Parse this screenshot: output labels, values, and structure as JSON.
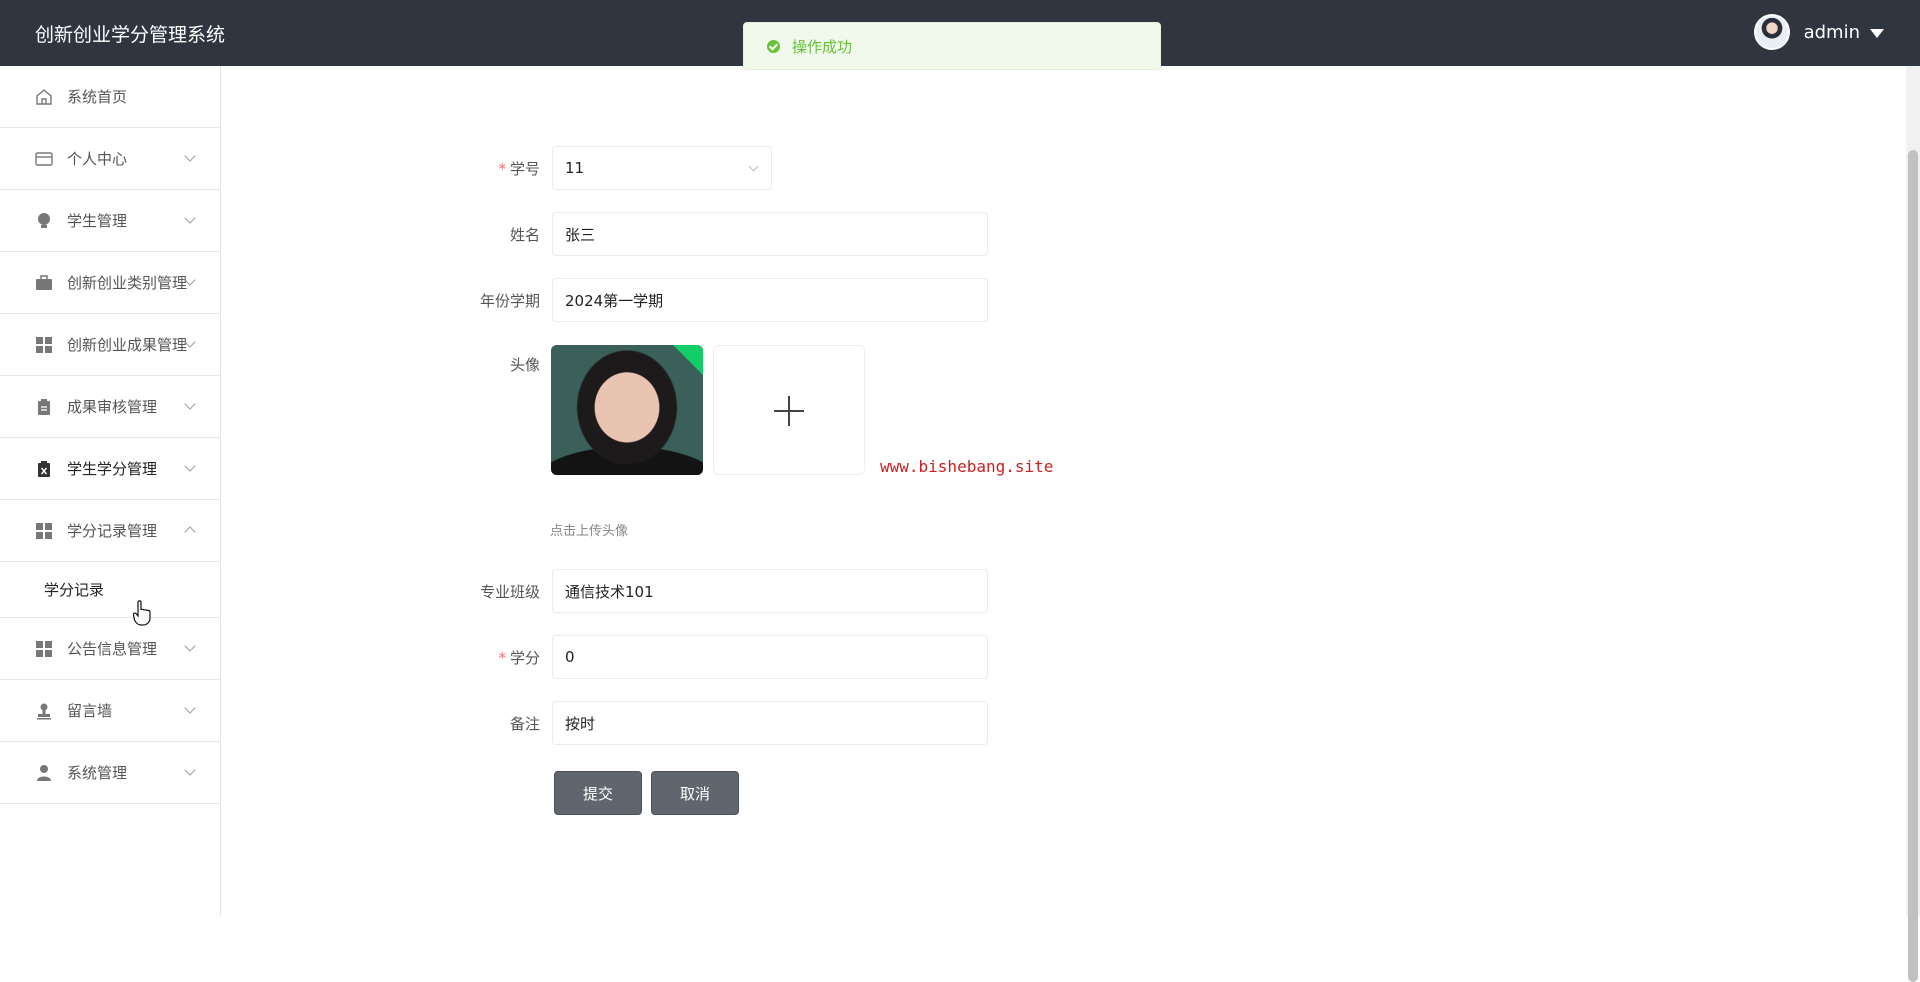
{
  "app": {
    "title": "创新创业学分管理系统"
  },
  "user": {
    "name": "admin"
  },
  "toast": {
    "message": "操作成功"
  },
  "sidebar": {
    "items": [
      {
        "label": "系统首页",
        "icon": "home-icon"
      },
      {
        "label": "个人中心",
        "icon": "wallet-icon"
      },
      {
        "label": "学生管理",
        "icon": "bulb-icon"
      },
      {
        "label": "创新创业类别管理",
        "icon": "briefcase-icon"
      },
      {
        "label": "创新创业成果管理",
        "icon": "grid-icon"
      },
      {
        "label": "成果审核管理",
        "icon": "clipboard-icon"
      },
      {
        "label": "学生学分管理",
        "icon": "clipboard-x-icon"
      },
      {
        "label": "学分记录管理",
        "icon": "grid-icon",
        "expanded": true
      },
      {
        "label": "公告信息管理",
        "icon": "grid-icon"
      },
      {
        "label": "留言墙",
        "icon": "stamp-icon"
      },
      {
        "label": "系统管理",
        "icon": "user-icon"
      }
    ],
    "submenu": {
      "label": "学分记录"
    }
  },
  "form": {
    "student_id": {
      "label": "学号",
      "value": "11",
      "required": true
    },
    "name": {
      "label": "姓名",
      "value": "张三"
    },
    "semester": {
      "label": "年份学期",
      "value": "2024第一学期"
    },
    "avatar": {
      "label": "头像",
      "hint": "点击上传头像"
    },
    "class": {
      "label": "专业班级",
      "value": "通信技术101"
    },
    "credit": {
      "label": "学分",
      "value": "0",
      "required": true
    },
    "remark": {
      "label": "备注",
      "value": "按时"
    },
    "submit_label": "提交",
    "cancel_label": "取消"
  },
  "watermark": "www.bishebang.site",
  "colors": {
    "header": "#2f3640",
    "success": "#67c23a",
    "button": "#5f666d",
    "required": "#f56c6c"
  }
}
